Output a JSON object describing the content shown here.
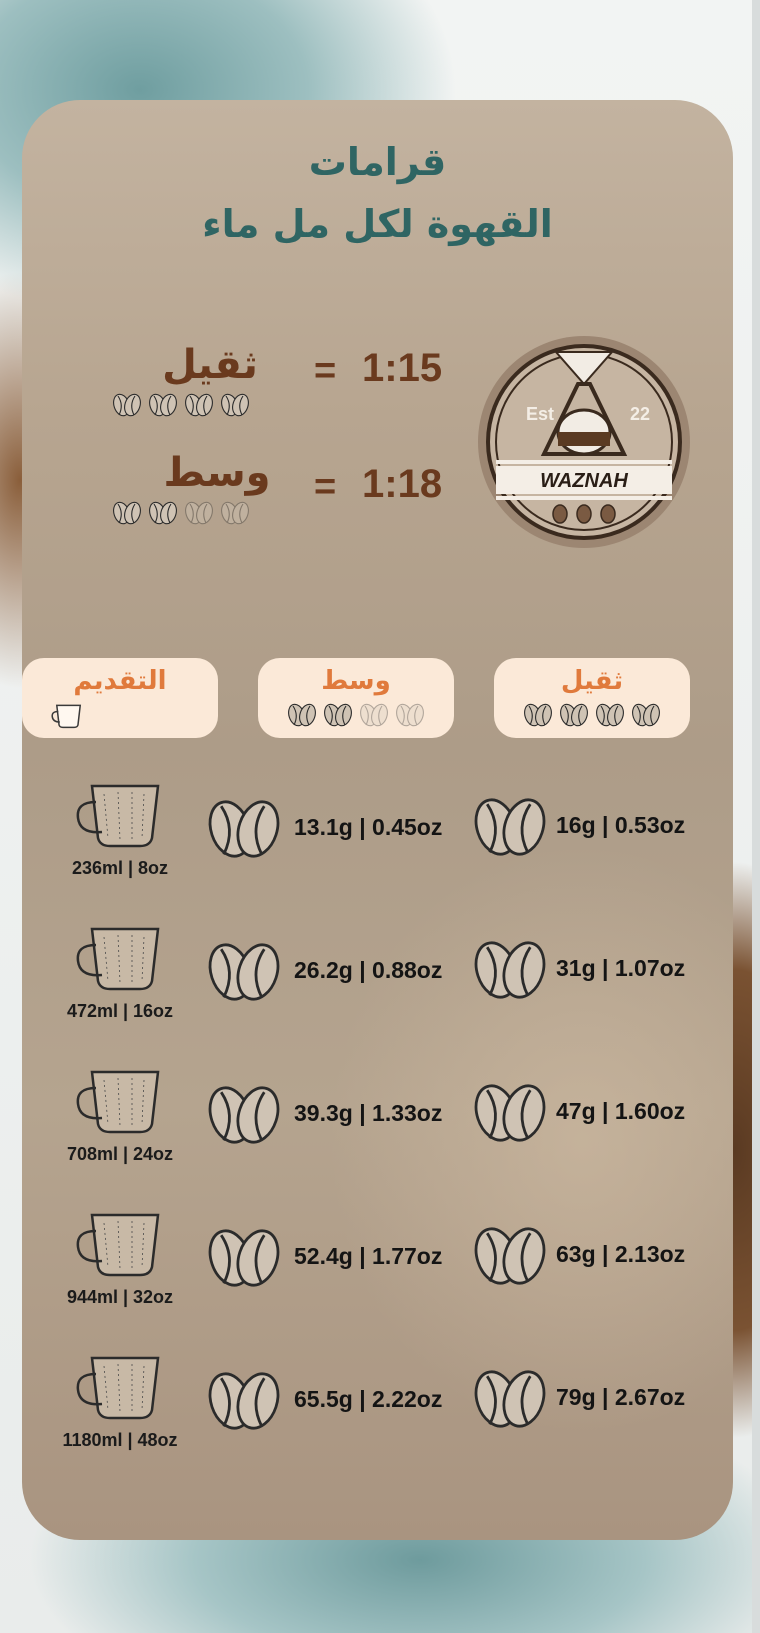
{
  "header": {
    "title_line1": "قرامات",
    "title_line2": "القهوة لكل مل ماء"
  },
  "ratios": [
    {
      "label": "ثقيل",
      "equals": "=",
      "value": "1:15",
      "beans_filled": 4,
      "beans_total": 4
    },
    {
      "label": "وسط",
      "equals": "=",
      "value": "1:18",
      "beans_filled": 2,
      "beans_total": 4
    }
  ],
  "logo": {
    "est_label": "Est",
    "est_value": "22",
    "brand": "WAZNAH",
    "icon": "pour-over-coffee-icon"
  },
  "tabs": [
    {
      "label": "التقديم",
      "icon": "cup-icon"
    },
    {
      "label": "وسط",
      "beans_filled": 2,
      "beans_total": 4
    },
    {
      "label": "ثقيل",
      "beans_filled": 4,
      "beans_total": 4
    }
  ],
  "rows": [
    {
      "serving": "236ml | 8oz",
      "medium": "13.1g | 0.45oz",
      "heavy": "16g | 0.53oz"
    },
    {
      "serving": "472ml | 16oz",
      "medium": "26.2g | 0.88oz",
      "heavy": "31g | 1.07oz"
    },
    {
      "serving": "708ml | 24oz",
      "medium": "39.3g | 1.33oz",
      "heavy": "47g | 1.60oz"
    },
    {
      "serving": "944ml | 32oz",
      "medium": "52.4g | 1.77oz",
      "heavy": "63g | 2.13oz"
    },
    {
      "serving": "1180ml | 48oz",
      "medium": "65.5g | 2.22oz",
      "heavy": "79g | 2.67oz"
    }
  ],
  "colors": {
    "title": "#2f6563",
    "ratio_text": "#6a3a1e",
    "tab_bg": "#fbe9d8",
    "tab_text": "#e07a3c"
  }
}
